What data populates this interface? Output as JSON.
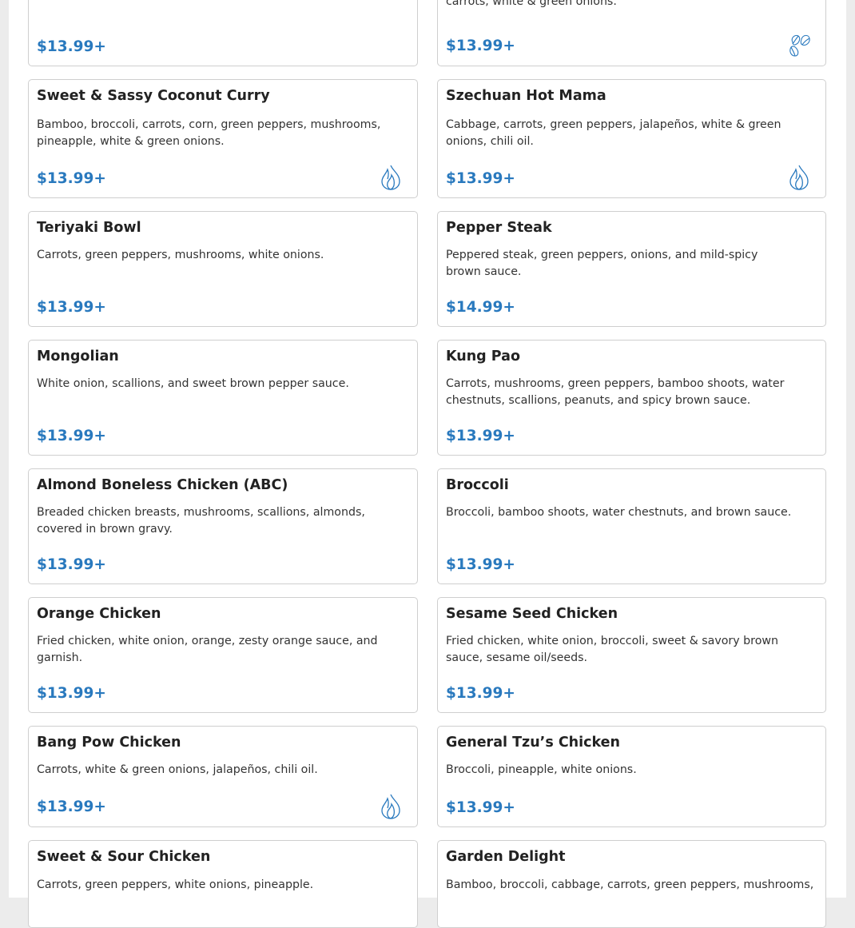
{
  "colors": {
    "price": "#2979be",
    "icon": "#2979be",
    "border": "#cfcfcf"
  },
  "icons": {
    "spicy": "flame-icon",
    "vegetarian": "leaf-icon"
  },
  "menu": {
    "items": [
      {
        "name": "",
        "description": "",
        "price": "$13.99+",
        "icon": null
      },
      {
        "name": "",
        "description": "carrots, white & green onions.",
        "price": "$13.99+",
        "icon": "leaf-icon"
      },
      {
        "name": "Sweet & Sassy Coconut Curry",
        "description": "Bamboo, broccoli, carrots, corn, green peppers, mushrooms, pineapple, white & green onions.",
        "price": "$13.99+",
        "icon": "flame-icon"
      },
      {
        "name": "Szechuan Hot Mama",
        "description": "Cabbage, carrots, green peppers, jalapeños, white & green onions, chili oil.",
        "price": "$13.99+",
        "icon": "flame-icon"
      },
      {
        "name": "Teriyaki Bowl",
        "description": "Carrots, green peppers, mushrooms, white onions.",
        "price": "$13.99+",
        "icon": null
      },
      {
        "name": "Pepper Steak",
        "description": "Peppered steak, green peppers, onions, and mild-spicy brown sauce.",
        "price": "$14.99+",
        "icon": null
      },
      {
        "name": "Mongolian",
        "description": "White onion, scallions, and sweet brown pepper sauce.",
        "price": "$13.99+",
        "icon": null
      },
      {
        "name": "Kung Pao",
        "description": "Carrots, mushrooms, green peppers, bamboo shoots, water chestnuts, scallions, peanuts, and spicy brown sauce.",
        "price": "$13.99+",
        "icon": null
      },
      {
        "name": "Almond Boneless Chicken (ABC)",
        "description": "Breaded chicken breasts, mushrooms, scallions, almonds, covered in brown gravy.",
        "price": "$13.99+",
        "icon": null
      },
      {
        "name": "Broccoli",
        "description": "Broccoli, bamboo shoots, water chestnuts, and brown sauce.",
        "price": "$13.99+",
        "icon": null
      },
      {
        "name": "Orange Chicken",
        "description": "Fried chicken, white onion, orange, zesty orange sauce, and garnish.",
        "price": "$13.99+",
        "icon": null
      },
      {
        "name": "Sesame Seed Chicken",
        "description": "Fried chicken, white onion, broccoli, sweet & savory brown sauce, sesame oil/seeds.",
        "price": "$13.99+",
        "icon": null
      },
      {
        "name": "Bang Pow Chicken",
        "description": "Carrots, white & green onions, jalapeños, chili oil.",
        "price": "$13.99+",
        "icon": "flame-icon"
      },
      {
        "name": "General Tzu’s Chicken",
        "description": "Broccoli, pineapple, white onions.",
        "price": "$13.99+",
        "icon": null
      },
      {
        "name": "Sweet & Sour Chicken",
        "description": "Carrots, green peppers, white onions, pineapple.",
        "price": "",
        "icon": null
      },
      {
        "name": "Garden Delight",
        "description": "Bamboo, broccoli, cabbage, carrots, green peppers, mushrooms,",
        "price": "",
        "icon": null
      }
    ]
  }
}
